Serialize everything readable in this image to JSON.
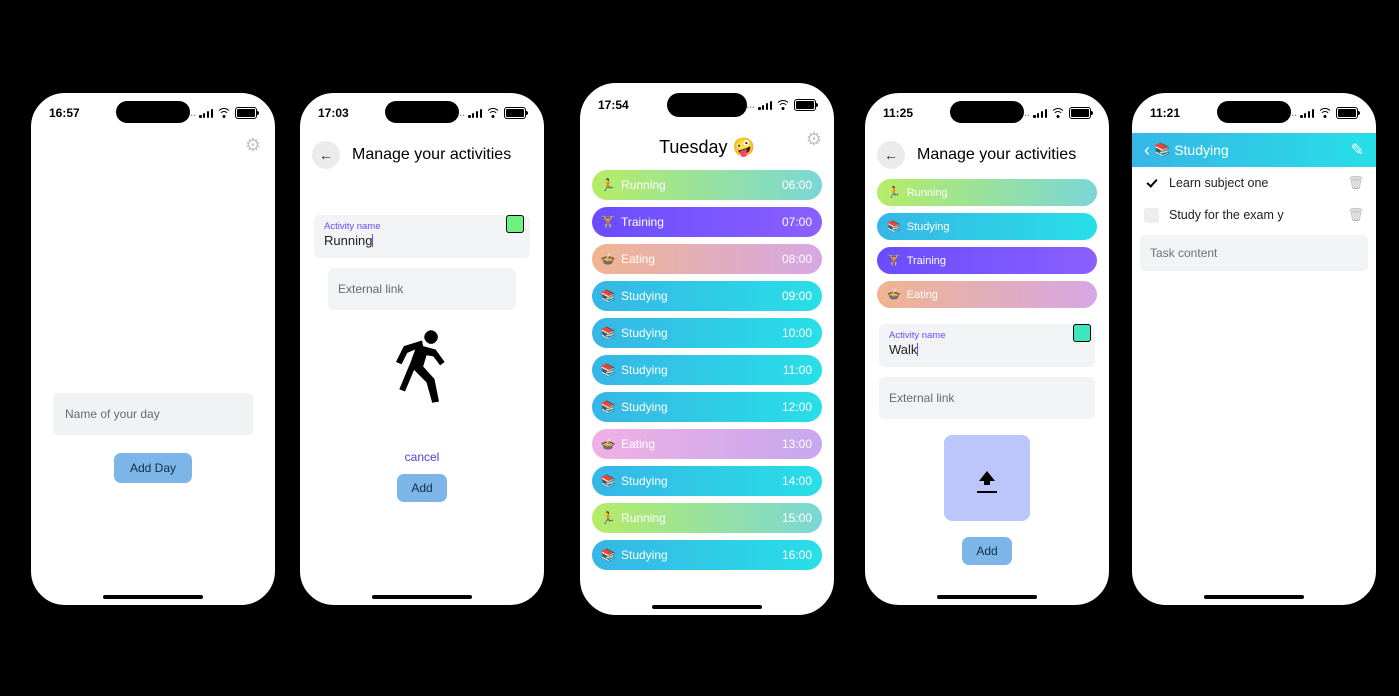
{
  "screens": {
    "s1": {
      "time": "16:57",
      "input_placeholder": "Name of your day",
      "add_day_btn": "Add Day"
    },
    "s2": {
      "time": "17:03",
      "title": "Manage your activities",
      "activity_lbl": "Activity name",
      "activity_val": "Running",
      "external_ph": "External link",
      "cancel": "cancel",
      "add_btn": "Add"
    },
    "s3": {
      "time": "17:54",
      "title": "Tuesday 🤪",
      "rows": [
        {
          "icon": "🏃",
          "name": "Running",
          "time": "06:00",
          "grad": "g-green"
        },
        {
          "icon": "🏋️",
          "name": "Training",
          "time": "07:00",
          "grad": "g-purple"
        },
        {
          "icon": "🍲",
          "name": "Eating",
          "time": "08:00",
          "grad": "g-peach"
        },
        {
          "icon": "📚",
          "name": "Studying",
          "time": "09:00",
          "grad": "g-cyan"
        },
        {
          "icon": "📚",
          "name": "Studying",
          "time": "10:00",
          "grad": "g-cyan"
        },
        {
          "icon": "📚",
          "name": "Studying",
          "time": "11:00",
          "grad": "g-cyan"
        },
        {
          "icon": "📚",
          "name": "Studying",
          "time": "12:00",
          "grad": "g-cyan"
        },
        {
          "icon": "🍲",
          "name": "Eating",
          "time": "13:00",
          "grad": "g-pink"
        },
        {
          "icon": "📚",
          "name": "Studying",
          "time": "14:00",
          "grad": "g-cyan"
        },
        {
          "icon": "🏃",
          "name": "Running",
          "time": "15:00",
          "grad": "g-green"
        },
        {
          "icon": "📚",
          "name": "Studying",
          "time": "16:00",
          "grad": "g-cyan"
        }
      ]
    },
    "s4": {
      "time": "11:25",
      "title": "Manage your activities",
      "chips": [
        {
          "icon": "🏃",
          "name": "Running",
          "grad": "g-green"
        },
        {
          "icon": "📚",
          "name": "Studying",
          "grad": "g-cyan"
        },
        {
          "icon": "🏋️",
          "name": "Training",
          "grad": "g-purple"
        },
        {
          "icon": "🍲",
          "name": "Eating",
          "grad": "g-peach"
        }
      ],
      "activity_lbl": "Activity name",
      "activity_val": "Walk",
      "external_ph": "External link",
      "add_btn": "Add"
    },
    "s5": {
      "time": "11:21",
      "title": "Studying",
      "tasks": [
        {
          "done": true,
          "label": "Learn subject one"
        },
        {
          "done": false,
          "label": "Study for the exam y"
        }
      ],
      "task_input_ph": "Task content"
    }
  }
}
